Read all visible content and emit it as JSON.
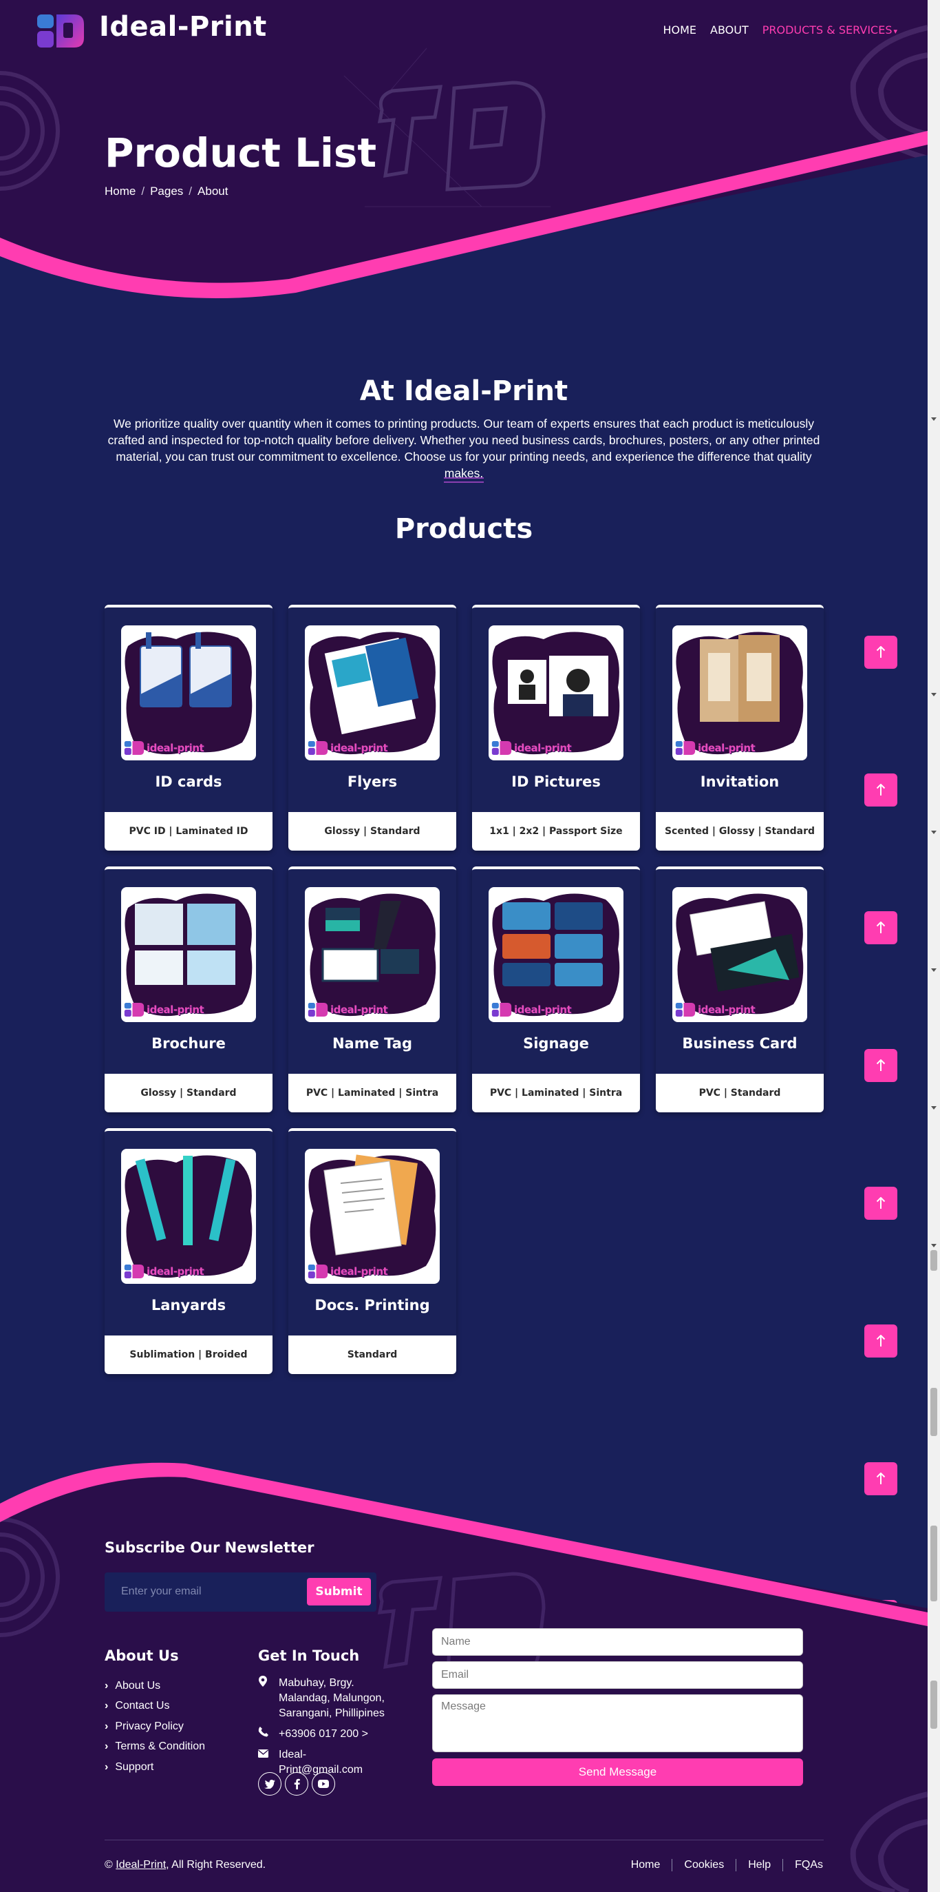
{
  "brand": {
    "name": "Ideal-Print"
  },
  "nav": {
    "items": [
      "HOME",
      "ABOUT",
      "PRODUCTS & SERVICES"
    ]
  },
  "hero": {
    "title": "Product List",
    "breadcrumb": [
      "Home",
      "Pages",
      "About"
    ]
  },
  "intro": {
    "title": "At Ideal-Print",
    "text": "We prioritize quality over quantity when it comes to printing products. Our team of experts ensures that each product is meticulously crafted and inspected for top-notch quality before delivery. Whether you need business cards, brochures, posters, or any other printed material, you can trust our commitment to excellence. Choose us for your printing needs, and experience the difference that quality makes."
  },
  "products": {
    "title": "Products",
    "watermark": "ideal-print",
    "items": [
      {
        "name": "ID cards",
        "options": "PVC ID | Laminated ID",
        "icon": "id-card-image"
      },
      {
        "name": "Flyers",
        "options": "Glossy | Standard",
        "icon": "flyer-image"
      },
      {
        "name": "ID Pictures",
        "options": "1x1 | 2x2 | Passport Size",
        "icon": "id-picture-image"
      },
      {
        "name": "Invitation",
        "options": "Scented | Glossy | Standard",
        "icon": "invitation-image"
      },
      {
        "name": "Brochure",
        "options": "Glossy | Standard",
        "icon": "brochure-image"
      },
      {
        "name": "Name Tag",
        "options": "PVC | Laminated | Sintra",
        "icon": "name-tag-image"
      },
      {
        "name": "Signage",
        "options": "PVC | Laminated | Sintra",
        "icon": "signage-image"
      },
      {
        "name": "Business Card",
        "options": "PVC | Standard",
        "icon": "business-card-image"
      },
      {
        "name": "Lanyards",
        "options": "Sublimation | Broided",
        "icon": "lanyard-image"
      },
      {
        "name": "Docs. Printing",
        "options": "Standard",
        "icon": "document-image"
      }
    ]
  },
  "footer": {
    "newsletter_title": "Subscribe Our Newsletter",
    "newsletter_placeholder": "Enter your email",
    "submit_label": "Submit",
    "about_title": "About Us",
    "about_links": [
      "About Us",
      "Contact Us",
      "Privacy Policy",
      "Terms & Condition",
      "Support"
    ],
    "contact_title": "Get In Touch",
    "address": "Mabuhay, Brgy. Malandag, Malungon, Sarangani, Phillipines",
    "phone": "+63906 017 200 >",
    "email": "Ideal-Print@gmail.com",
    "form": {
      "name_placeholder": "Name",
      "email_placeholder": "Email",
      "message_placeholder": "Message",
      "send_label": "Send Message"
    },
    "copyright_prefix": "©",
    "copyright_link": "Ideal-Print",
    "copyright_suffix": ", All Right Reserved.",
    "bottom_links": [
      "Home",
      "Cookies",
      "Help",
      "FQAs"
    ]
  },
  "colors": {
    "accent": "#ff3db1",
    "hero_bg": "#2c0d4b",
    "page_bg": "#19205a",
    "footer_bg": "#2a0e4a"
  }
}
